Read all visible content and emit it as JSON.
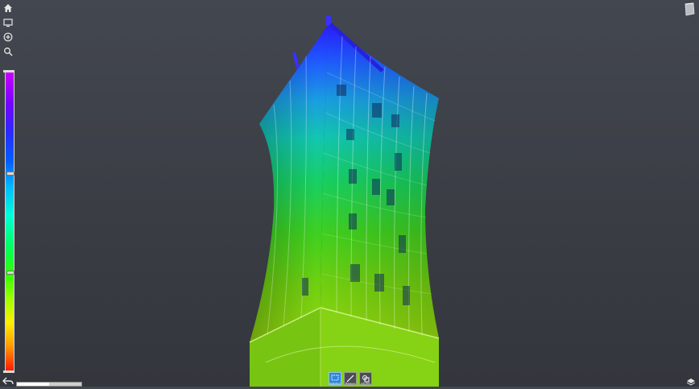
{
  "toolbar": {
    "icons": [
      "home-icon",
      "monitor-icon",
      "add-circle-icon",
      "search-icon"
    ]
  },
  "colorbar": {
    "colors": [
      "#cc00ff",
      "#2a2aff",
      "#00b8ff",
      "#00ff66",
      "#a0ff00",
      "#ffee00",
      "#ff1a00"
    ],
    "handle_levels": [
      0.34,
      0.67
    ]
  },
  "bottom_tools": [
    {
      "icon": "selection-rect-icon",
      "label": "Selection",
      "active": true
    },
    {
      "icon": "measure-icon",
      "label": "Measure",
      "active": false
    },
    {
      "icon": "clip-box-icon",
      "label": "Clip Box",
      "active": false
    }
  ],
  "colors": {
    "accent": "#2f86d8",
    "background": "#3a3d44"
  }
}
